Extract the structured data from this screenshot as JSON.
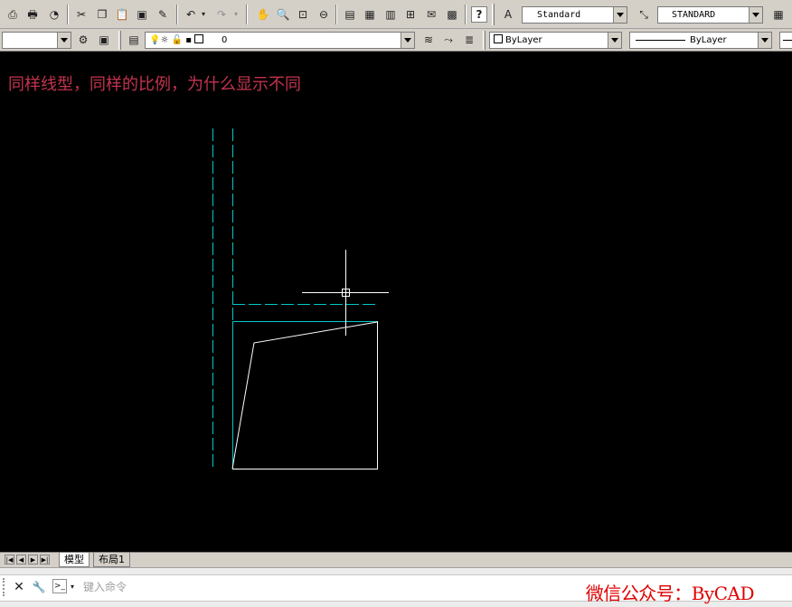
{
  "toolbar_top": {
    "icons": [
      "preview-icon",
      "plot-icon",
      "publish-icon",
      "cut-icon",
      "copy-icon",
      "paste-icon",
      "match-properties-icon",
      "brush-icon",
      "undo-icon",
      "redo-icon",
      "pan-icon",
      "zoom-realtime-icon",
      "zoom-window-icon",
      "zoom-previous-icon",
      "properties-icon",
      "design-center-icon",
      "tool-palettes-icon",
      "sheet-set-icon",
      "markup-icon",
      "calculator-icon",
      "help-icon"
    ],
    "text_style": "Standard",
    "dim_style": "STANDARD"
  },
  "toolbar_layers": {
    "workspace": "",
    "layer_name": "0",
    "color": "ByLayer",
    "linetype": "ByLayer"
  },
  "canvas": {
    "background": "#000000",
    "note": "同样线型，同样的比例，为什么显示不同",
    "note_color": "#c3334e",
    "cyan": "#00c8c8",
    "white": "#ffffff"
  },
  "tabs": {
    "model": "模型",
    "layout": "布局1"
  },
  "command": {
    "placeholder": "键入命令",
    "watermark": "微信公众号：ByCAD",
    "watermark_color": "#e00000"
  }
}
